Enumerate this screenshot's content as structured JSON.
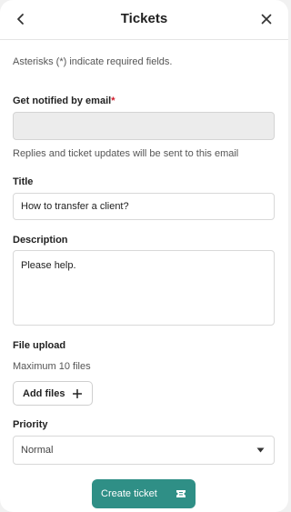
{
  "header": {
    "title": "Tickets",
    "back_icon": "chevron-left-icon",
    "close_icon": "close-icon"
  },
  "required_note": "Asterisks (*) indicate required fields.",
  "email": {
    "label": "Get notified by email",
    "required_marker": "*",
    "value": "",
    "helper": "Replies and ticket updates will be sent to this email"
  },
  "title_field": {
    "label": "Title",
    "value": "How to transfer a client?"
  },
  "description": {
    "label": "Description",
    "value": "Please help."
  },
  "file_upload": {
    "label": "File upload",
    "helper": "Maximum 10 files",
    "button_label": "Add files",
    "button_icon": "plus-icon"
  },
  "priority": {
    "label": "Priority",
    "selected": "Normal",
    "dropdown_icon": "caret-down-icon"
  },
  "submit": {
    "label": "Create ticket",
    "icon": "ticket-icon"
  },
  "colors": {
    "accent": "#2f8f86",
    "required": "#d11a2a",
    "disabled_bg": "#ececec"
  }
}
